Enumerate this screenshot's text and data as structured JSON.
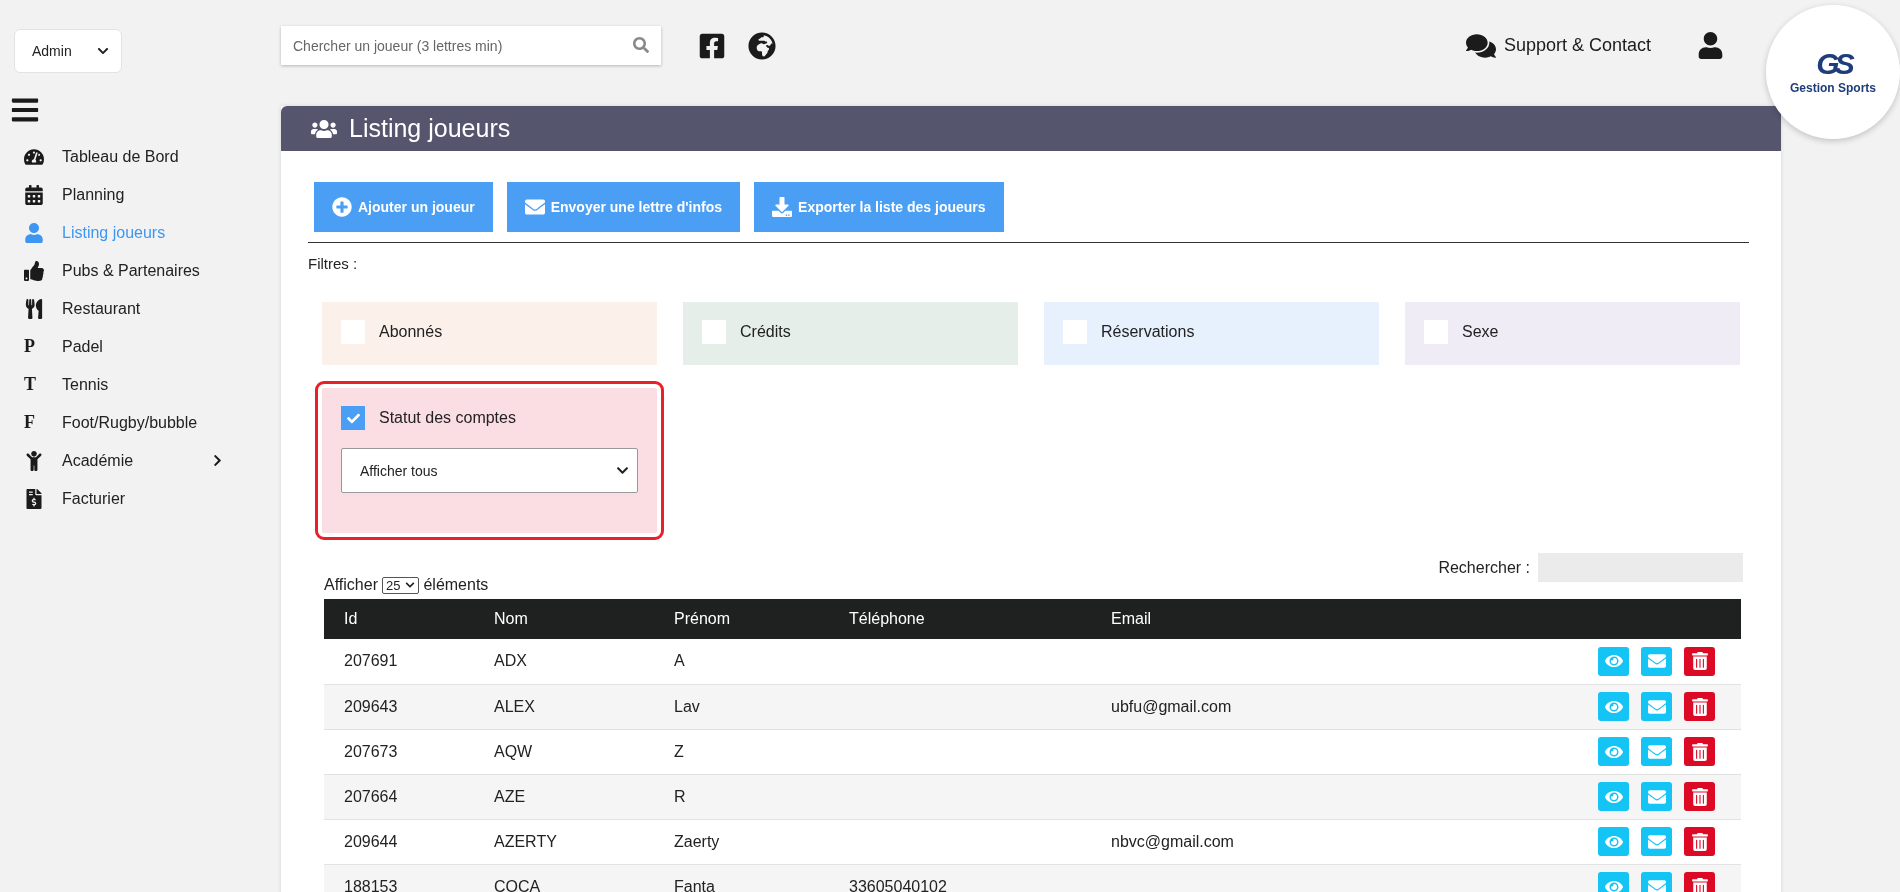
{
  "role_select": {
    "value": "Admin"
  },
  "search": {
    "placeholder": "Chercher un joueur (3 lettres min)"
  },
  "support": {
    "label": "Support & Contact"
  },
  "logo": {
    "mark": "GS",
    "name": "Gestion Sports"
  },
  "sidebar": {
    "items": [
      {
        "label": "Tableau de Bord",
        "kind": "icon",
        "selected": false
      },
      {
        "label": "Planning",
        "kind": "icon",
        "selected": false
      },
      {
        "label": "Listing joueurs",
        "kind": "icon",
        "selected": true
      },
      {
        "label": "Pubs & Partenaires",
        "kind": "icon",
        "selected": false
      },
      {
        "label": "Restaurant",
        "kind": "icon",
        "selected": false
      },
      {
        "label": "Padel",
        "kind": "letter",
        "letter": "P",
        "selected": false
      },
      {
        "label": "Tennis",
        "kind": "letter",
        "letter": "T",
        "selected": false
      },
      {
        "label": "Foot/Rugby/bubble",
        "kind": "letter",
        "letter": "F",
        "selected": false
      },
      {
        "label": "Académie",
        "kind": "icon",
        "expandable": true,
        "selected": false
      },
      {
        "label": "Facturier",
        "kind": "icon",
        "selected": false
      }
    ]
  },
  "panel": {
    "title": "Listing joueurs",
    "actions": [
      "Ajouter un joueur",
      "Envoyer une lettre d'infos",
      "Exporter la liste des joueurs"
    ],
    "filters_label": "Filtres :",
    "filters": [
      {
        "label": "Abonnés",
        "checked": false,
        "color": "#fbf1ea"
      },
      {
        "label": "Crédits",
        "checked": false,
        "color": "#e6eeea"
      },
      {
        "label": "Réservations",
        "checked": false,
        "color": "#e6f1fd"
      },
      {
        "label": "Sexe",
        "checked": false,
        "color": "#efecf5"
      },
      {
        "label": "Statut des comptes",
        "checked": true,
        "color": "#fbdde4",
        "highlighted": true,
        "select": "Afficher tous"
      }
    ],
    "length": {
      "before": "Afficher",
      "value": "25",
      "after": "éléments"
    },
    "table_search": {
      "label": "Rechercher :"
    },
    "table": {
      "columns": [
        "Id",
        "Nom",
        "Prénom",
        "Téléphone",
        "Email"
      ],
      "rows": [
        [
          "207691",
          "ADX",
          "A",
          "",
          ""
        ],
        [
          "209643",
          "ALEX",
          "Lav",
          "",
          "ubfu@gmail.com"
        ],
        [
          "207673",
          "AQW",
          "Z",
          "",
          ""
        ],
        [
          "207664",
          "AZE",
          "R",
          "",
          ""
        ],
        [
          "209644",
          "AZERTY",
          "Zaerty",
          "",
          "nbvc@gmail.com"
        ],
        [
          "188153",
          "COCA",
          "Fanta",
          "33605040102",
          ""
        ]
      ]
    }
  }
}
